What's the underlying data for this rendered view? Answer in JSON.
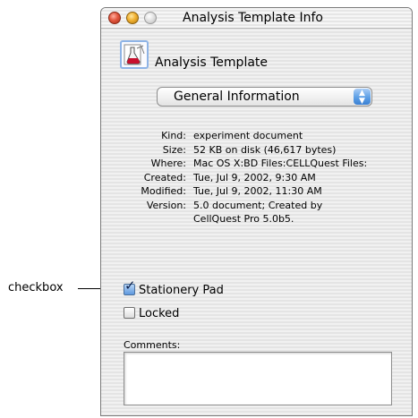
{
  "callout": {
    "label": "checkbox"
  },
  "window": {
    "title": "Analysis Template Info",
    "traffic_lights": [
      "close",
      "minimize",
      "zoom"
    ],
    "doc_icon": "document-flask-icon",
    "doc_name": "Analysis Template",
    "section_popup": {
      "selected": "General Information"
    },
    "info_rows": [
      {
        "key": "Kind:",
        "value": "experiment document"
      },
      {
        "key": "Size:",
        "value": "52 KB on disk (46,617 bytes)"
      },
      {
        "key": "Where:",
        "value": "Mac OS X:BD Files:CELLQuest Files:"
      },
      {
        "key": "Created:",
        "value": "Tue, Jul 9, 2002, 9:30 AM"
      },
      {
        "key": "Modified:",
        "value": "Tue, Jul 9, 2002, 11:30 AM"
      },
      {
        "key": "Version:",
        "value": "5.0 document; Created by",
        "value2": "CellQuest Pro 5.0b5."
      }
    ],
    "checkboxes": [
      {
        "label": "Stationery Pad",
        "checked": true
      },
      {
        "label": "Locked",
        "checked": false
      }
    ],
    "comments": {
      "label": "Comments:",
      "value": ""
    }
  },
  "colors": {
    "close": "#e2563e",
    "minimize": "#f0b030",
    "zoom": "#dcdcdc",
    "accent": "#5c9fe6"
  }
}
